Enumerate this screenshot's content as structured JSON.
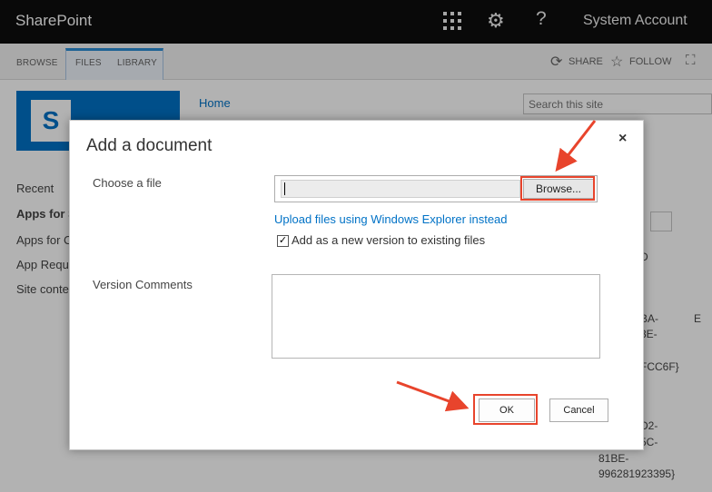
{
  "suitebar": {
    "brand": "SharePoint",
    "account": "System Account",
    "icons": [
      "app-launcher-icon",
      "gear-icon",
      "help-icon"
    ]
  },
  "ribbon": {
    "tabs": [
      "BROWSE",
      "FILES",
      "LIBRARY"
    ],
    "actions": [
      {
        "label": "SHARE",
        "icon": "sync-icon"
      },
      {
        "label": "FOLLOW",
        "icon": "star-icon"
      }
    ]
  },
  "page": {
    "home": "Home",
    "search_placeholder": "Search this site",
    "leftnav": [
      "Recent",
      "Apps for S",
      "Apps for C",
      "App Requ",
      "Site conte"
    ],
    "background_text": [
      "D",
      "BA-",
      "3E-",
      "FCC6F}",
      "E",
      "D2-",
      "5C-",
      "81BE-",
      "996281923395}"
    ]
  },
  "dialog": {
    "title": "Add a document",
    "close": "×",
    "choose_file_label": "Choose a file",
    "browse": "Browse...",
    "upload_link": "Upload files using Windows Explorer instead",
    "add_version_checked": true,
    "add_version_label": "Add as a new version to existing files",
    "version_comments_label": "Version Comments",
    "version_comments_value": "",
    "ok": "OK",
    "cancel": "Cancel"
  },
  "colors": {
    "suitebar": "#0e0e0e",
    "accent": "#0072c6",
    "highlight": "#e8442c"
  }
}
